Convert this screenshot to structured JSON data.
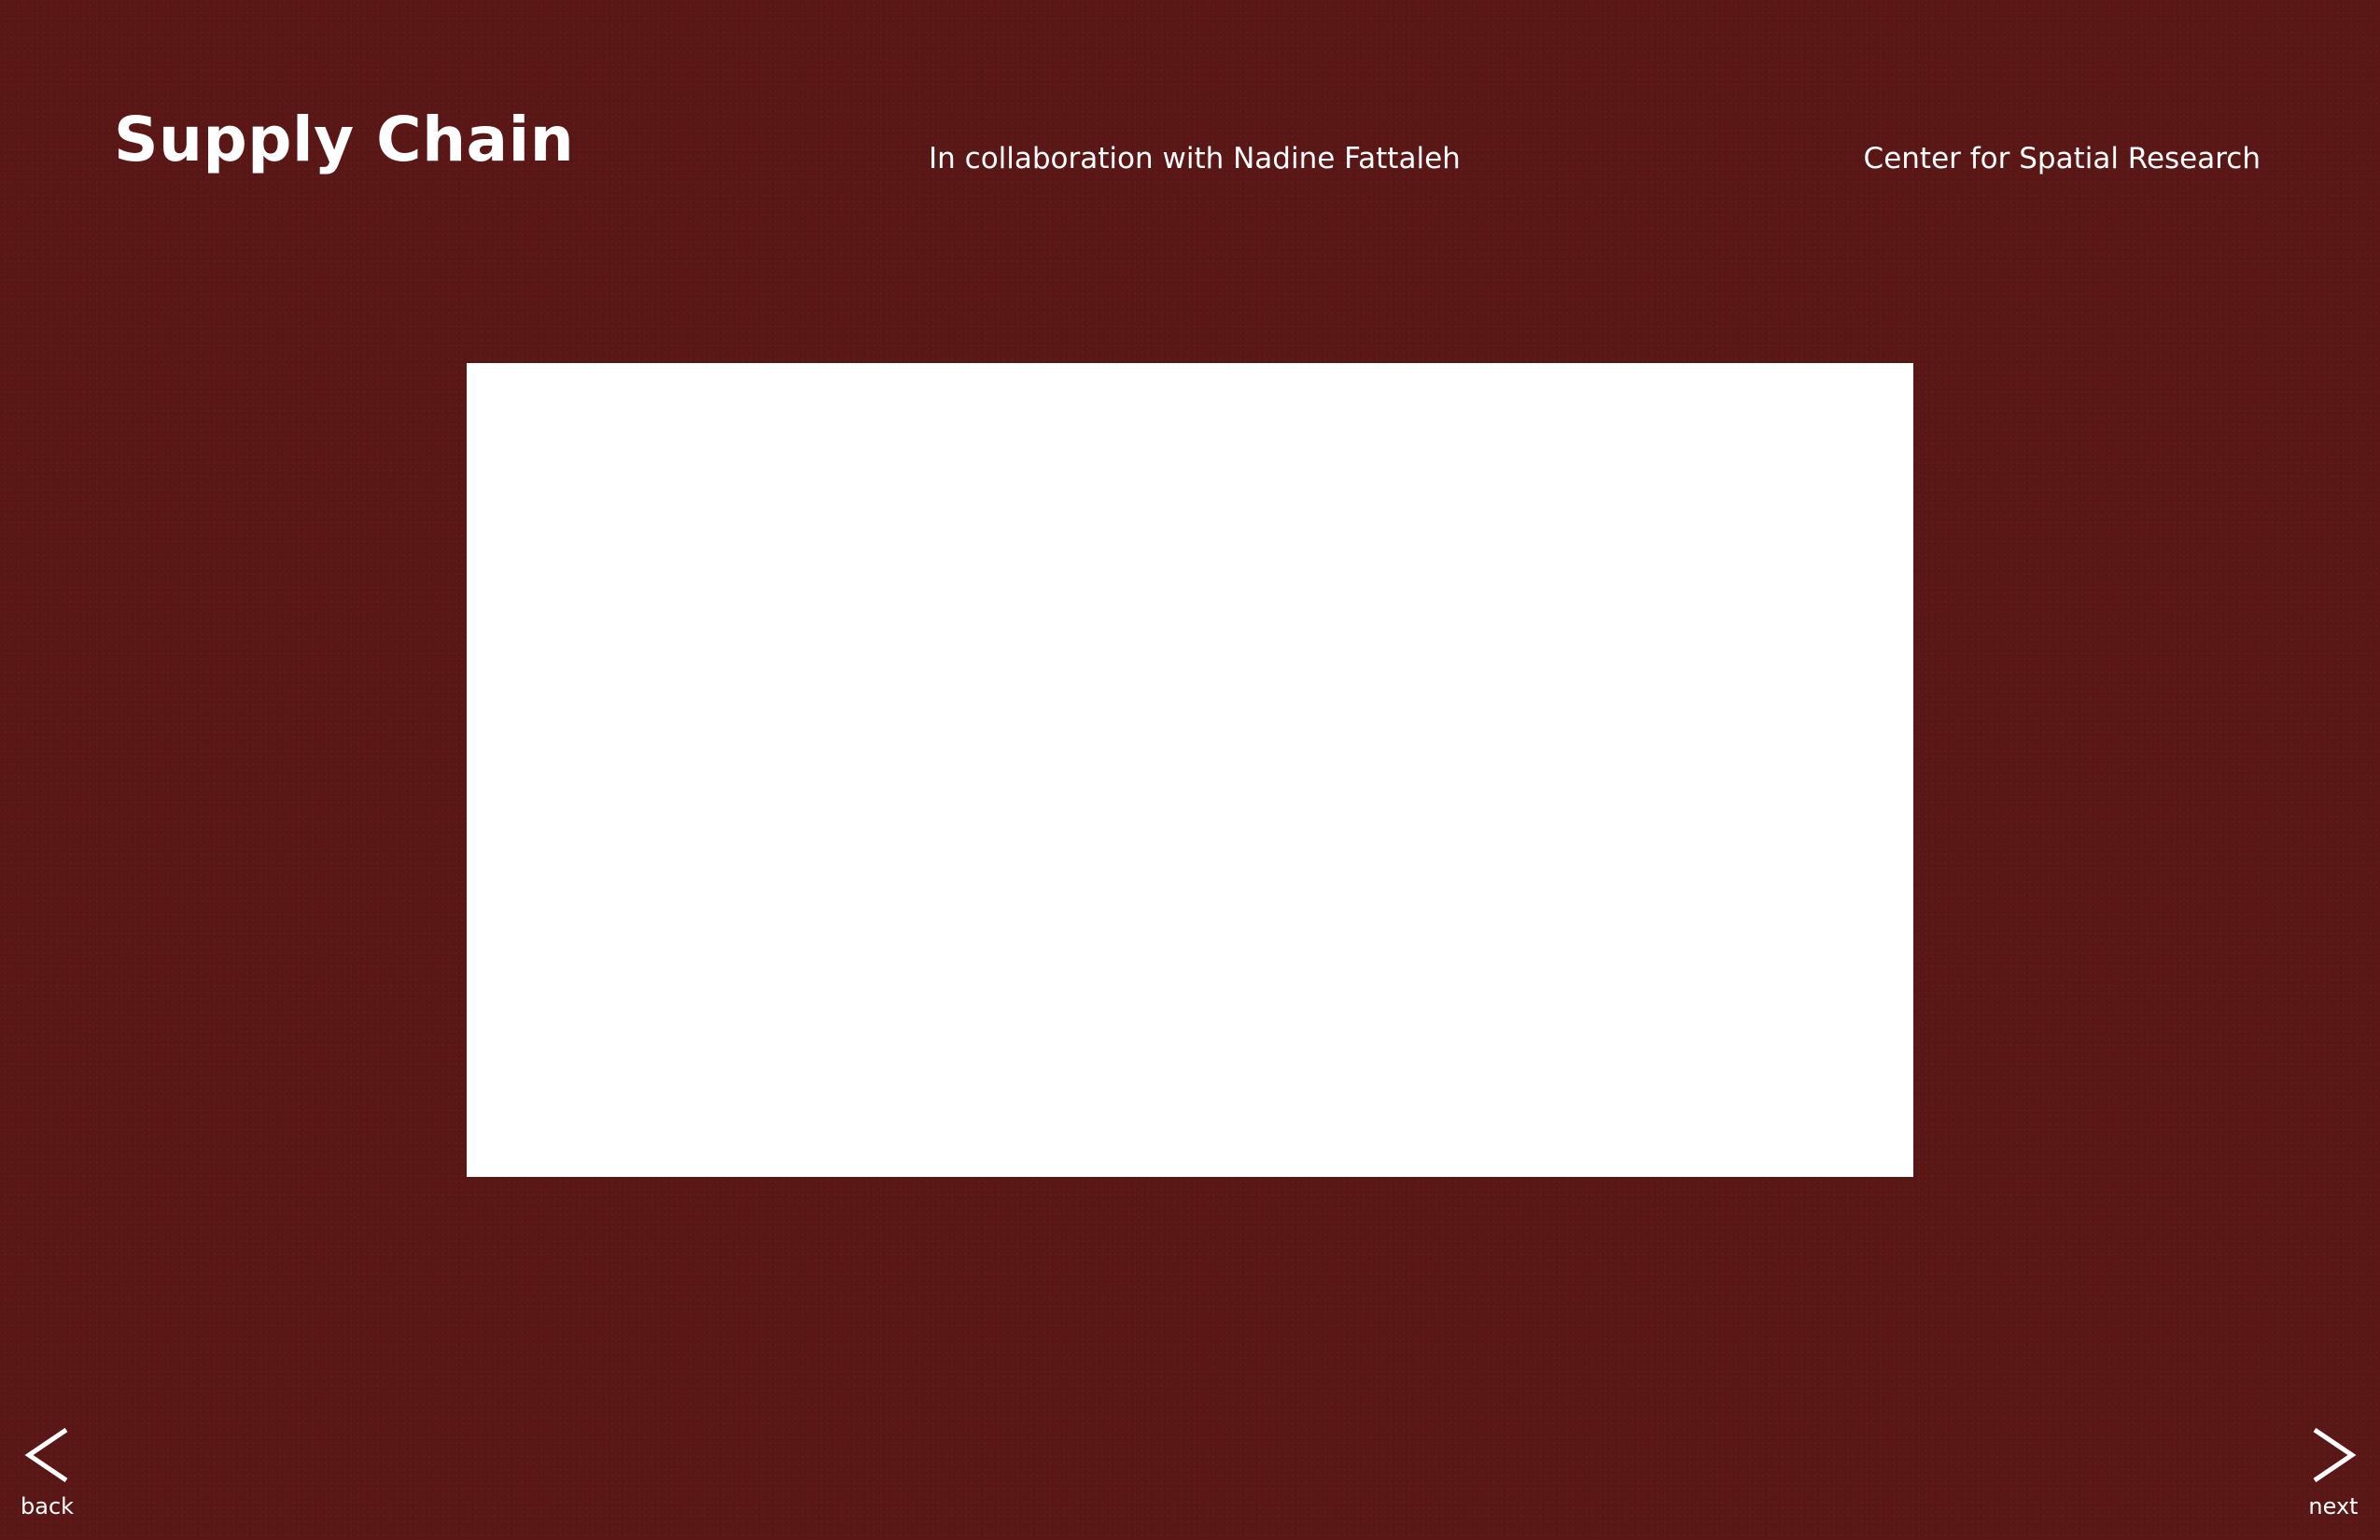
{
  "header": {
    "title": "Supply Chain",
    "collaboration": "In collaboration with Nadine Fattaleh",
    "organization": "Center for Spatial Research"
  },
  "navigation": {
    "back": {
      "label": "back",
      "icon": "chevron-left-icon"
    },
    "next": {
      "label": "next",
      "icon": "chevron-right-icon"
    }
  },
  "colors": {
    "background": "#5a1716",
    "text": "#ffffff",
    "media_frame": "#ffffff"
  }
}
